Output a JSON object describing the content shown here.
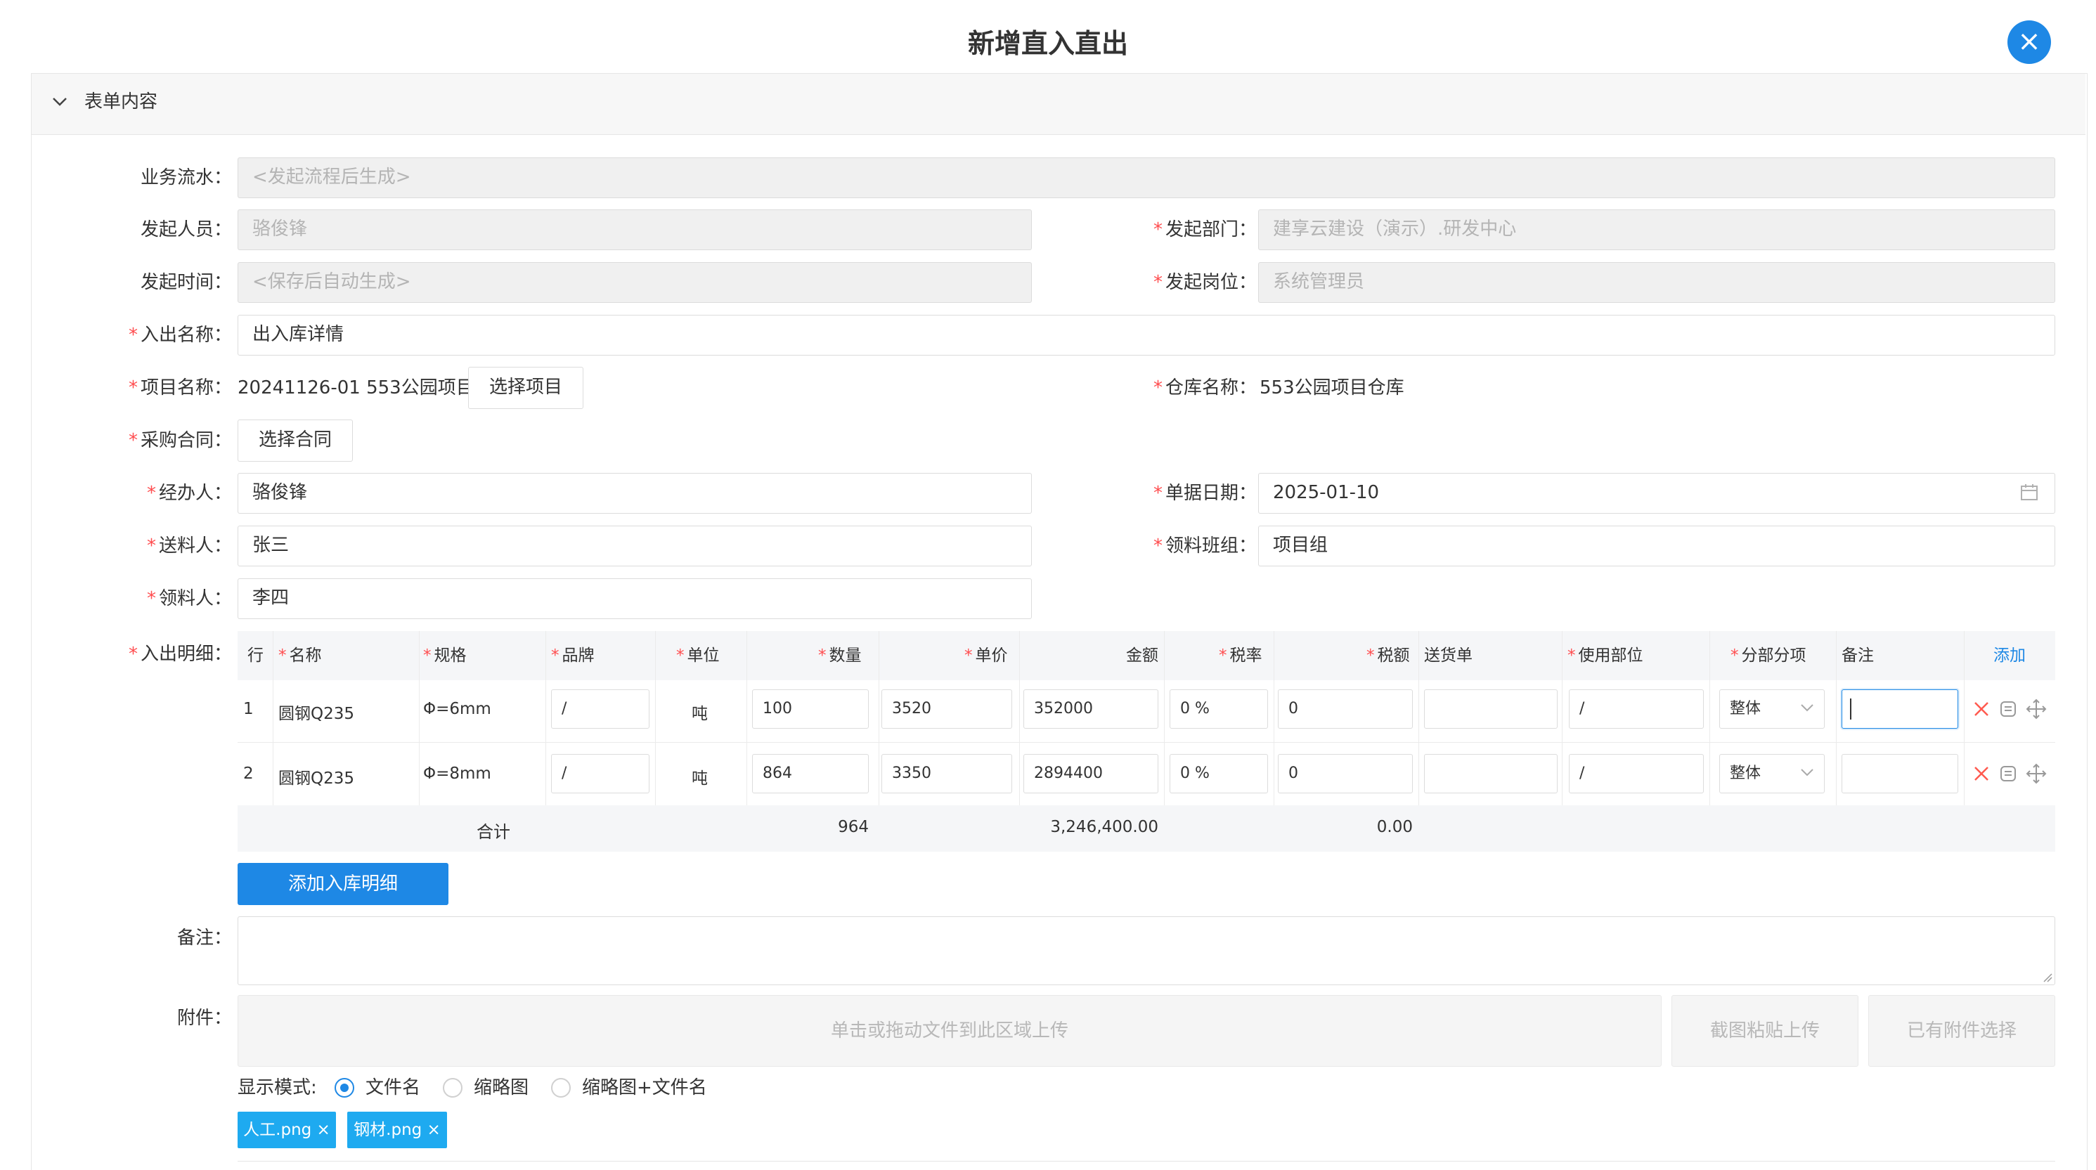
{
  "dialog": {
    "title": "新增直入直出",
    "close_icon": "×"
  },
  "panel": {
    "title": "表单内容",
    "chevron": "⌄"
  },
  "form": {
    "business_flow": {
      "label": "业务流水",
      "placeholder": "<发起流程后生成>"
    },
    "initiator": {
      "label": "发起人员",
      "value": "骆俊锋"
    },
    "dept": {
      "label": "发起部门",
      "value": "建享云建设（演示）.研发中心"
    },
    "start_time": {
      "label": "发起时间",
      "placeholder": "<保存后自动生成>"
    },
    "post": {
      "label": "发起岗位",
      "value": "系统管理员"
    },
    "io_name": {
      "label": "入出名称",
      "value": "出入库详情"
    },
    "project": {
      "label": "项目名称",
      "value": "20241126-01  553公园项目",
      "button": "选择项目"
    },
    "warehouse": {
      "label": "仓库名称",
      "value": "553公园项目仓库"
    },
    "contract": {
      "label": "采购合同",
      "button": "选择合同"
    },
    "handler": {
      "label": "经办人",
      "value": "骆俊锋"
    },
    "doc_date": {
      "label": "单据日期",
      "value": "2025-01-10"
    },
    "deliverer": {
      "label": "送料人",
      "value": "张三"
    },
    "team": {
      "label": "领料班组",
      "value": "项目组"
    },
    "receiver": {
      "label": "领料人",
      "value": "李四"
    },
    "detail_label": "入出明细",
    "remark_label": "备注",
    "attach_label": "附件",
    "colon": "："
  },
  "grid": {
    "headers": {
      "row": "行",
      "name": "名称",
      "spec": "规格",
      "brand": "品牌",
      "unit": "单位",
      "qty": "数量",
      "price": "单价",
      "amount": "金额",
      "tax_rate": "税率",
      "tax": "税额",
      "delivery": "送货单",
      "usage": "使用部位",
      "division": "分部分项",
      "remark": "备注",
      "add": "添加"
    },
    "rows": [
      {
        "row": "1",
        "name": "圆钢Q235",
        "spec": "Φ=6mm",
        "brand": "/",
        "unit": "吨",
        "qty": "100",
        "price": "3520",
        "amount": "352000",
        "tax_rate": "0 %",
        "tax": "0",
        "delivery": "",
        "usage": "/",
        "division": "整体",
        "remark": ""
      },
      {
        "row": "2",
        "name": "圆钢Q235",
        "spec": "Φ=8mm",
        "brand": "/",
        "unit": "吨",
        "qty": "864",
        "price": "3350",
        "amount": "2894400",
        "tax_rate": "0 %",
        "tax": "0",
        "delivery": "",
        "usage": "/",
        "division": "整体",
        "remark": ""
      }
    ],
    "summary": {
      "label": "合计",
      "qty": "964",
      "amount": "3,246,400.00",
      "tax": "0.00"
    },
    "add_detail_button": "添加入库明细"
  },
  "attachments": {
    "drop_text": "单击或拖动文件到此区域上传",
    "paste_button": "截图粘贴上传",
    "existing_button": "已有附件选择",
    "display_mode_label": "显示模式:",
    "modes": [
      "文件名",
      "缩略图",
      "缩略图+文件名"
    ],
    "selected_mode": "文件名",
    "files": [
      "人工.png ×",
      "钢材.png ×"
    ]
  },
  "colors": {
    "accent": "#1e88e5",
    "required": "#ff4d4f",
    "tag": "#1eaaf0"
  }
}
